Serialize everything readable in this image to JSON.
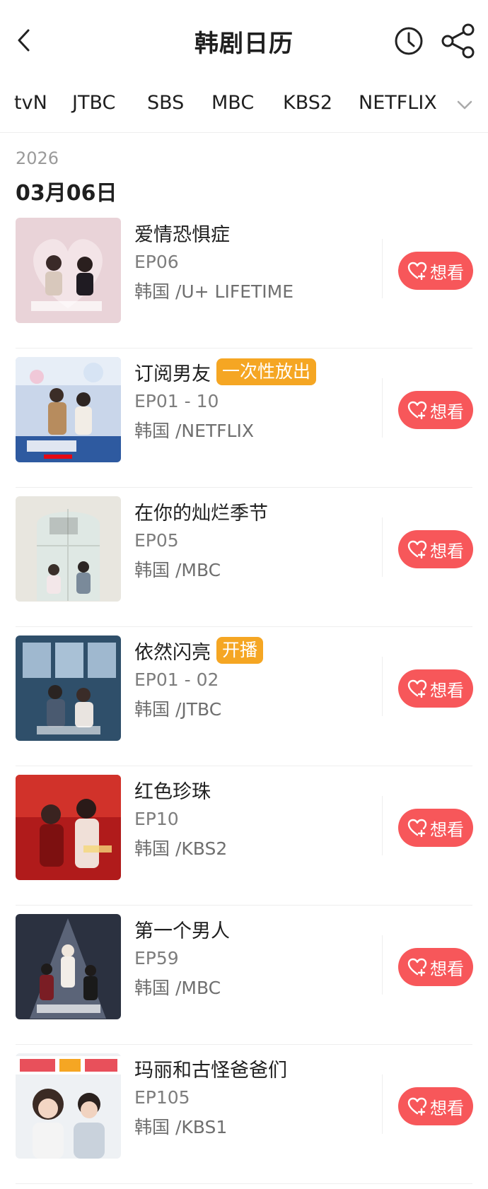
{
  "header": {
    "title": "韩剧日历"
  },
  "tabs": [
    "tvN",
    "JTBC",
    "SBS",
    "MBC",
    "KBS2",
    "NETFLIX"
  ],
  "section": {
    "year": "2026",
    "date": "03月06日"
  },
  "shows": [
    {
      "title": "爱情恐惧症",
      "badge": "",
      "episode": "EP06",
      "channel": "韩国 /U+ LIFETIME",
      "button": "想看"
    },
    {
      "title": "订阅男友",
      "badge": "一次性放出",
      "episode": "EP01 - 10",
      "channel": "韩国 /NETFLIX",
      "button": "想看"
    },
    {
      "title": "在你的灿烂季节",
      "badge": "",
      "episode": "EP05",
      "channel": "韩国 /MBC",
      "button": "想看"
    },
    {
      "title": "依然闪亮",
      "badge": "开播",
      "episode": "EP01 - 02",
      "channel": "韩国 /JTBC",
      "button": "想看"
    },
    {
      "title": "红色珍珠",
      "badge": "",
      "episode": "EP10",
      "channel": "韩国 /KBS2",
      "button": "想看"
    },
    {
      "title": "第一个男人",
      "badge": "",
      "episode": "EP59",
      "channel": "韩国 /MBC",
      "button": "想看"
    },
    {
      "title": "玛丽和古怪爸爸们",
      "badge": "",
      "episode": "EP105",
      "channel": "韩国 /KBS1",
      "button": "想看"
    }
  ],
  "colors": {
    "accent": "#f7575a",
    "badge": "#f5a623"
  },
  "icons": {
    "back": "chevron-left-icon",
    "history": "clock-icon",
    "share": "share-icon",
    "more": "chevron-down-icon",
    "want": "heart-plus-icon"
  }
}
